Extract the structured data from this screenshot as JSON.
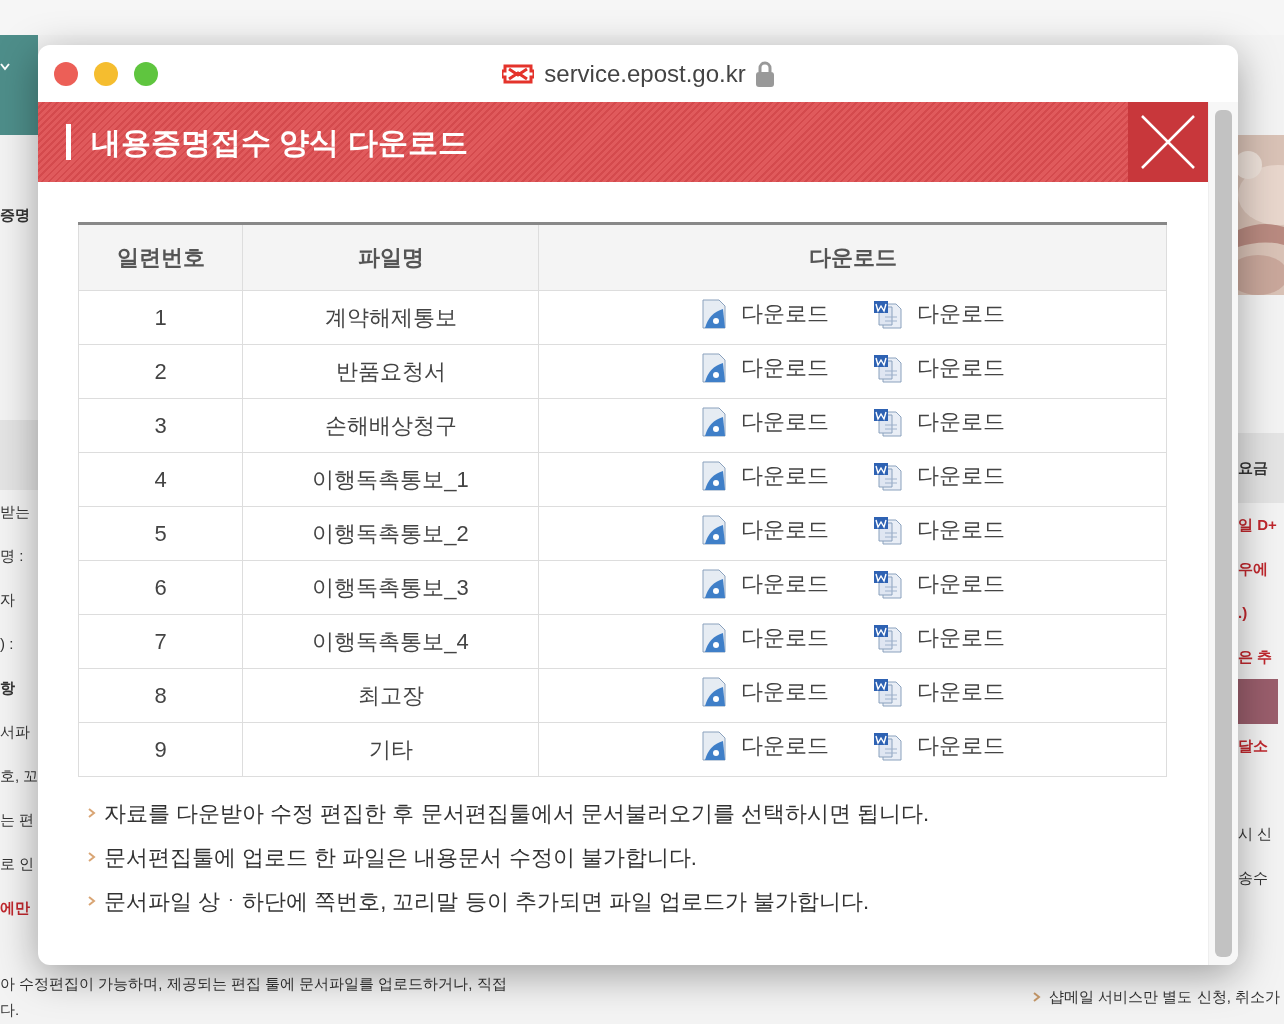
{
  "browser": {
    "url": "service.epost.go.kr",
    "secure": true
  },
  "dialog": {
    "title": "내용증명접수 양식 다운로드"
  },
  "table": {
    "columns": [
      "일련번호",
      "파일명",
      "다운로드"
    ],
    "rows": [
      {
        "number": "1",
        "file_name": "계약해제통보",
        "downloads": [
          "다운로드",
          "다운로드"
        ]
      },
      {
        "number": "2",
        "file_name": "반품요청서",
        "downloads": [
          "다운로드",
          "다운로드"
        ]
      },
      {
        "number": "3",
        "file_name": "손해배상청구",
        "downloads": [
          "다운로드",
          "다운로드"
        ]
      },
      {
        "number": "4",
        "file_name": "이행독촉통보_1",
        "downloads": [
          "다운로드",
          "다운로드"
        ]
      },
      {
        "number": "5",
        "file_name": "이행독촉통보_2",
        "downloads": [
          "다운로드",
          "다운로드"
        ]
      },
      {
        "number": "6",
        "file_name": "이행독촉통보_3",
        "downloads": [
          "다운로드",
          "다운로드"
        ]
      },
      {
        "number": "7",
        "file_name": "이행독촉통보_4",
        "downloads": [
          "다운로드",
          "다운로드"
        ]
      },
      {
        "number": "8",
        "file_name": "최고장",
        "downloads": [
          "다운로드",
          "다운로드"
        ]
      },
      {
        "number": "9",
        "file_name": "기타",
        "downloads": [
          "다운로드",
          "다운로드"
        ]
      }
    ]
  },
  "notes": [
    "자료를 다운받아 수정 편집한 후 문서편집툴에서 문서불러오기를 선택하시면 됩니다.",
    "문서편집툴에 업로드 한 파일은 내용문서 수정이 불가합니다.",
    "문서파일 상ㆍ하단에 쪽번호, 꼬리말 등이 추가되면 파일 업로드가 불가합니다."
  ],
  "background": {
    "left_heading": "증명",
    "left_lines": [
      {
        "text": "받는",
        "kind": "plain"
      },
      {
        "text": "명 :",
        "kind": "plain"
      },
      {
        "text": "자",
        "kind": "plain"
      },
      {
        "text": ") :",
        "kind": "plain"
      },
      {
        "text": "항",
        "kind": "bold"
      },
      {
        "text": "서파",
        "kind": "plain"
      },
      {
        "text": "호, 꼬",
        "kind": "plain"
      },
      {
        "text": "는 편",
        "kind": "plain"
      },
      {
        "text": "로 인",
        "kind": "plain"
      },
      {
        "text": "에만",
        "kind": "red"
      }
    ],
    "right_heading": "요금",
    "right_lines": [
      {
        "text": "일 D+",
        "kind": "red"
      },
      {
        "text": "우에",
        "kind": "red"
      },
      {
        "text": ".)",
        "kind": "red"
      },
      {
        "text": "은 추",
        "kind": "red"
      },
      {
        "kind": "button"
      },
      {
        "text": "달소",
        "kind": "red"
      },
      {
        "kind": "gap"
      },
      {
        "text": "시 신",
        "kind": "plain"
      },
      {
        "text": "송수",
        "kind": "plain"
      }
    ],
    "bottom_left": [
      "아 수정편집이 가능하며, 제공되는 편집 툴에 문서파일를 업로드하거나, 직접",
      "다."
    ],
    "bottom_right": "샵메일 서비스만 별도 신청, 취소가"
  }
}
